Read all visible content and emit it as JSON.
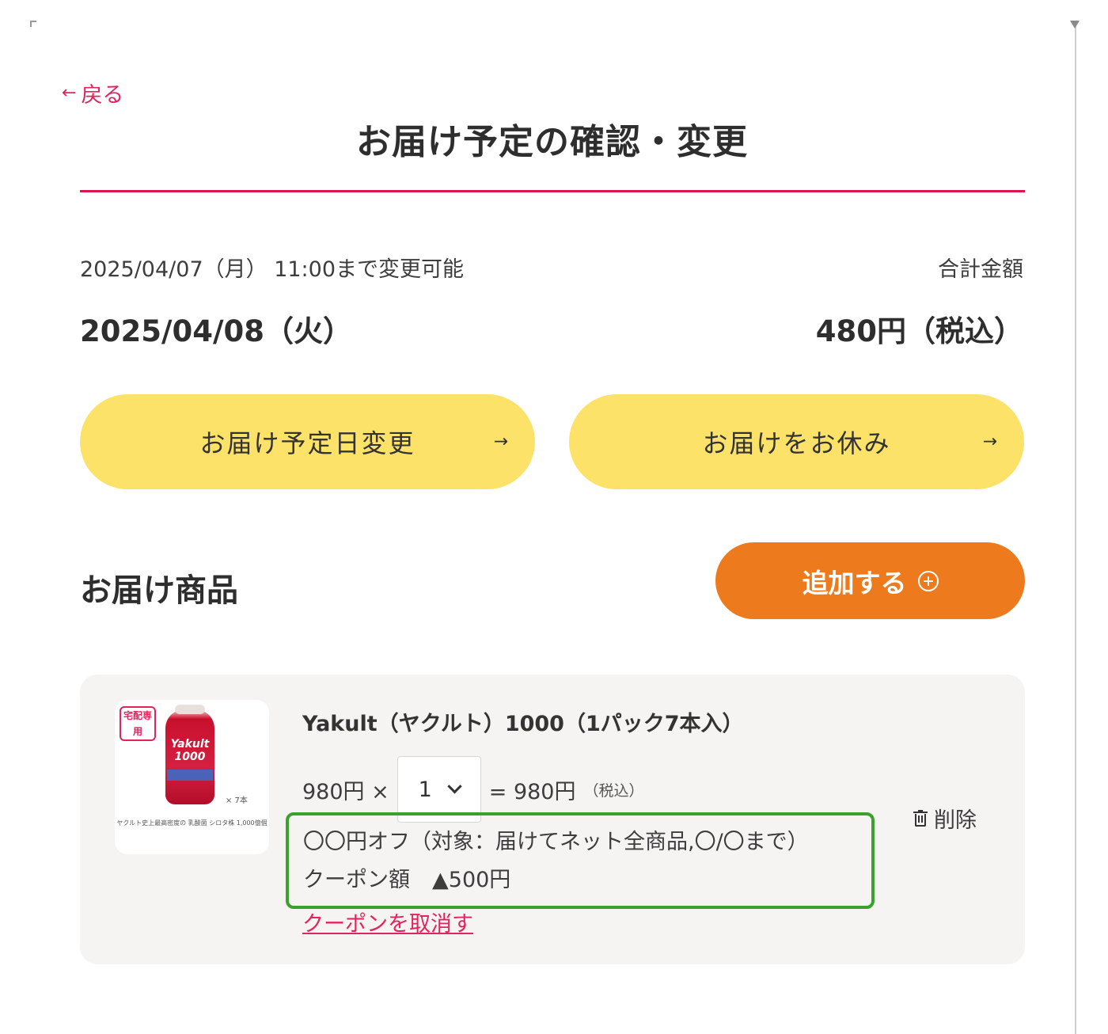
{
  "header": {
    "back_label": "戻る",
    "back_arrow": "←",
    "title": "お届け予定の確認・変更"
  },
  "summary": {
    "deadline": "2025/04/07（月） 11:00まで変更可能",
    "total_label": "合計金額",
    "delivery_date": "2025/04/08（火）",
    "total_value": "480円（税込）"
  },
  "actions": {
    "change_date_label": "お届け予定日変更",
    "skip_label": "お届けをお休み",
    "arrow": "→"
  },
  "products_section": {
    "title": "お届け商品",
    "add_label": "追加する"
  },
  "product": {
    "badge": "宅配専用",
    "bottle_text": "Yakult 1000",
    "pack_note": "× 7本",
    "image_caption": "ヤクルト史上最高密度の 乳酸菌 シロタ株 1,000億個",
    "name": "Yakult（ヤクルト）1000（1パック7本入）",
    "unit_price": "980円 ×",
    "quantity": "1",
    "subtotal": "= 980円",
    "tax_note": "（税込）",
    "delete_label": "削除",
    "coupon_description": "〇〇円オフ（対象：届けてネット全商品,〇/〇まで）",
    "coupon_amount_label": "クーポン額",
    "coupon_amount": "▲500円",
    "coupon_cancel_label": "クーポンを取消す"
  },
  "colors": {
    "accent_red": "#d9164f",
    "link_pink": "#e0245e",
    "pill_yellow": "#fde26a",
    "add_orange": "#ee7a1e",
    "coupon_outline_green": "#3aa12a",
    "card_bg": "#f5f4f2"
  },
  "icons": [
    "back-arrow-icon",
    "arrow-right-icon",
    "plus-circle-icon",
    "chevron-down-icon",
    "trash-icon"
  ]
}
